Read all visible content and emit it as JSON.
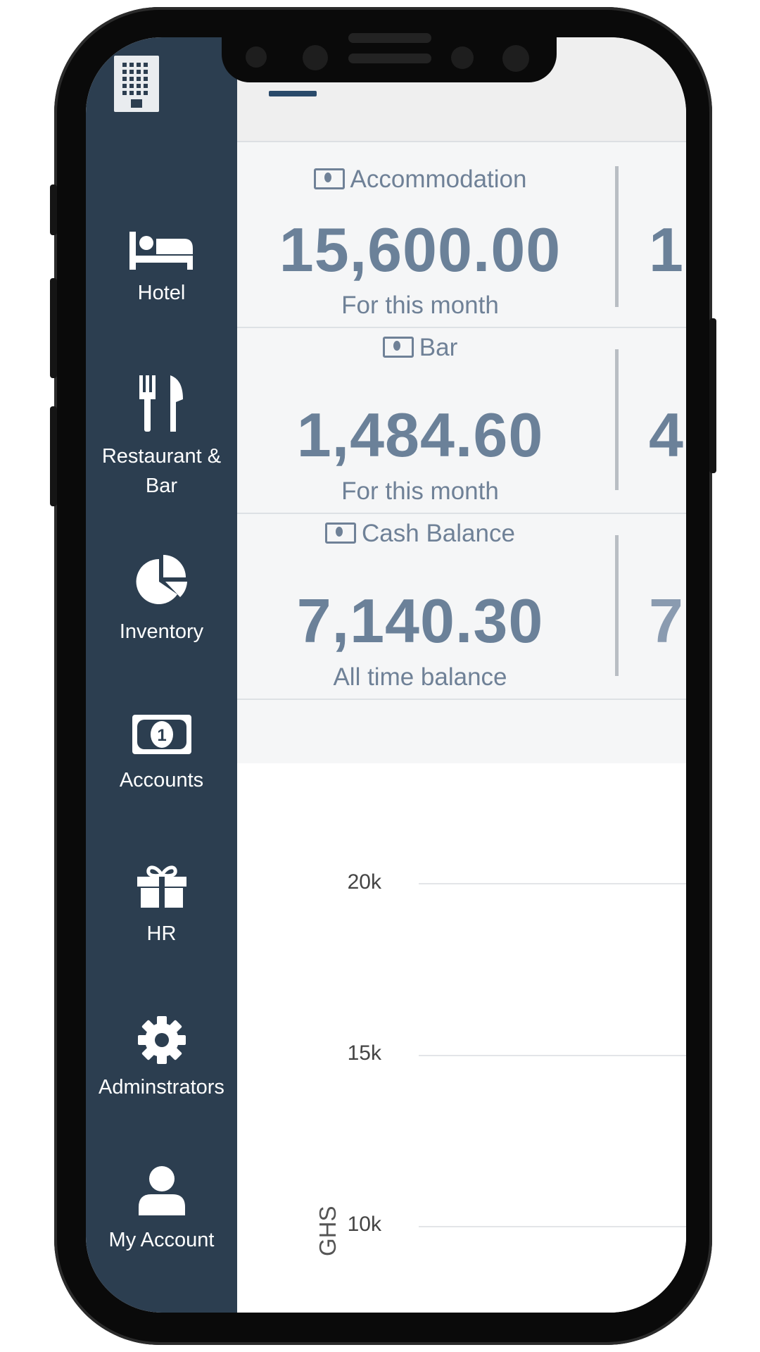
{
  "sidebar": {
    "logo_icon": "building-icon",
    "items": [
      {
        "label": "Hotel",
        "icon": "bed-icon"
      },
      {
        "label": "Restaurant &",
        "label2": "Bar",
        "icon": "fork-knife-icon"
      },
      {
        "label": "Inventory",
        "icon": "pie-chart-icon"
      },
      {
        "label": "Accounts",
        "icon": "money-icon"
      },
      {
        "label": "HR",
        "icon": "gift-icon"
      },
      {
        "label": "Adminstrators",
        "icon": "gear-icon"
      },
      {
        "label": "My Account",
        "icon": "user-icon"
      }
    ]
  },
  "header": {
    "menu_icon": "hamburger-icon"
  },
  "cards": [
    {
      "title": "Accommodation",
      "value": "15,600.00",
      "subtitle": "For this month",
      "peek": "1"
    },
    {
      "title": "Bar",
      "value": "1,484.60",
      "subtitle": "For this month",
      "peek": "4"
    },
    {
      "title": "Cash Balance",
      "value": "7,140.30",
      "subtitle": "All time balance",
      "peek": "7"
    }
  ],
  "chart_data": {
    "type": "bar",
    "ylabel": "GHS",
    "yticks": [
      "20k",
      "15k",
      "10k"
    ]
  },
  "colors": {
    "sidebar_bg": "#2c3e50",
    "accent": "#2a4a6a",
    "stat_text": "#6b8199"
  }
}
